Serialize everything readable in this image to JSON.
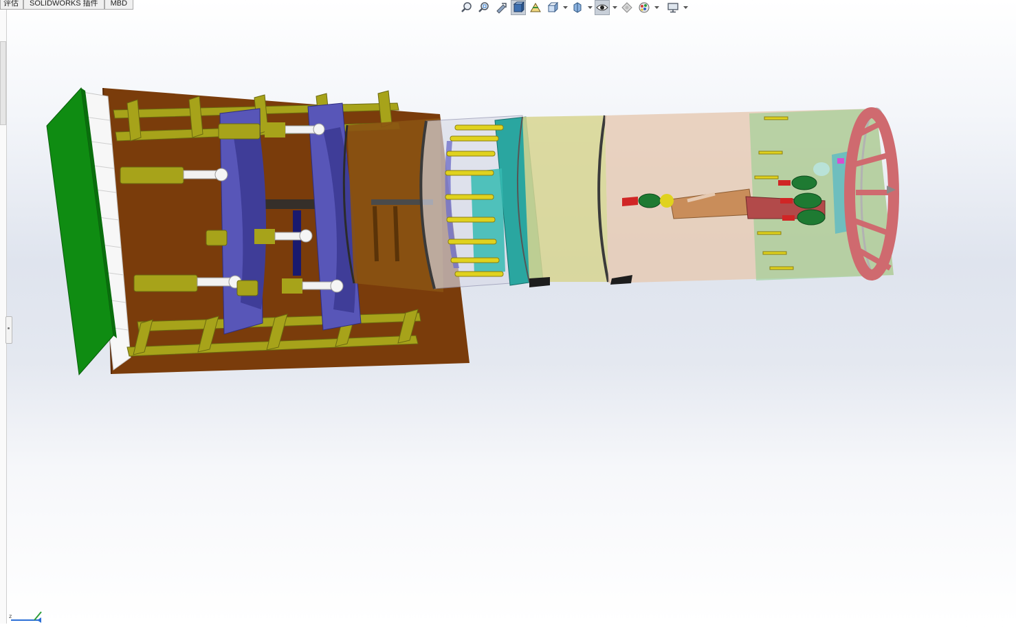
{
  "command_tabs": [
    {
      "label": "评估"
    },
    {
      "label": "SOLIDWORKS 插件"
    },
    {
      "label": "MBD"
    }
  ],
  "view_toolbar": {
    "items": [
      {
        "icon": "zoom-to-fit-icon"
      },
      {
        "icon": "zoom-to-area-icon"
      },
      {
        "icon": "previous-view-icon"
      },
      {
        "icon": "section-view-icon",
        "active": true
      },
      {
        "icon": "dynamic-annotation-views-icon"
      },
      {
        "icon": "view-orientation-icon"
      },
      {
        "icon": "display-style-icon"
      },
      {
        "icon": "hide-show-items-icon",
        "active": true
      },
      {
        "icon": "edit-appearance-icon"
      },
      {
        "icon": "apply-scene-icon"
      },
      {
        "icon": "view-settings-icon"
      }
    ]
  },
  "model": {
    "name": "pipe-jacking tunnel boring machine assembly",
    "colors": {
      "base_plate": "#7a3c0b",
      "wall_green": "#0f8c12",
      "rail_olive": "#a7a31a",
      "ring_purple": "#5856b8",
      "shield_front": "#e6c9b1",
      "cutterhead": "#cf6a6f",
      "cyl_yellow": "#e0d21e",
      "teal": "#2aa6a0"
    }
  }
}
